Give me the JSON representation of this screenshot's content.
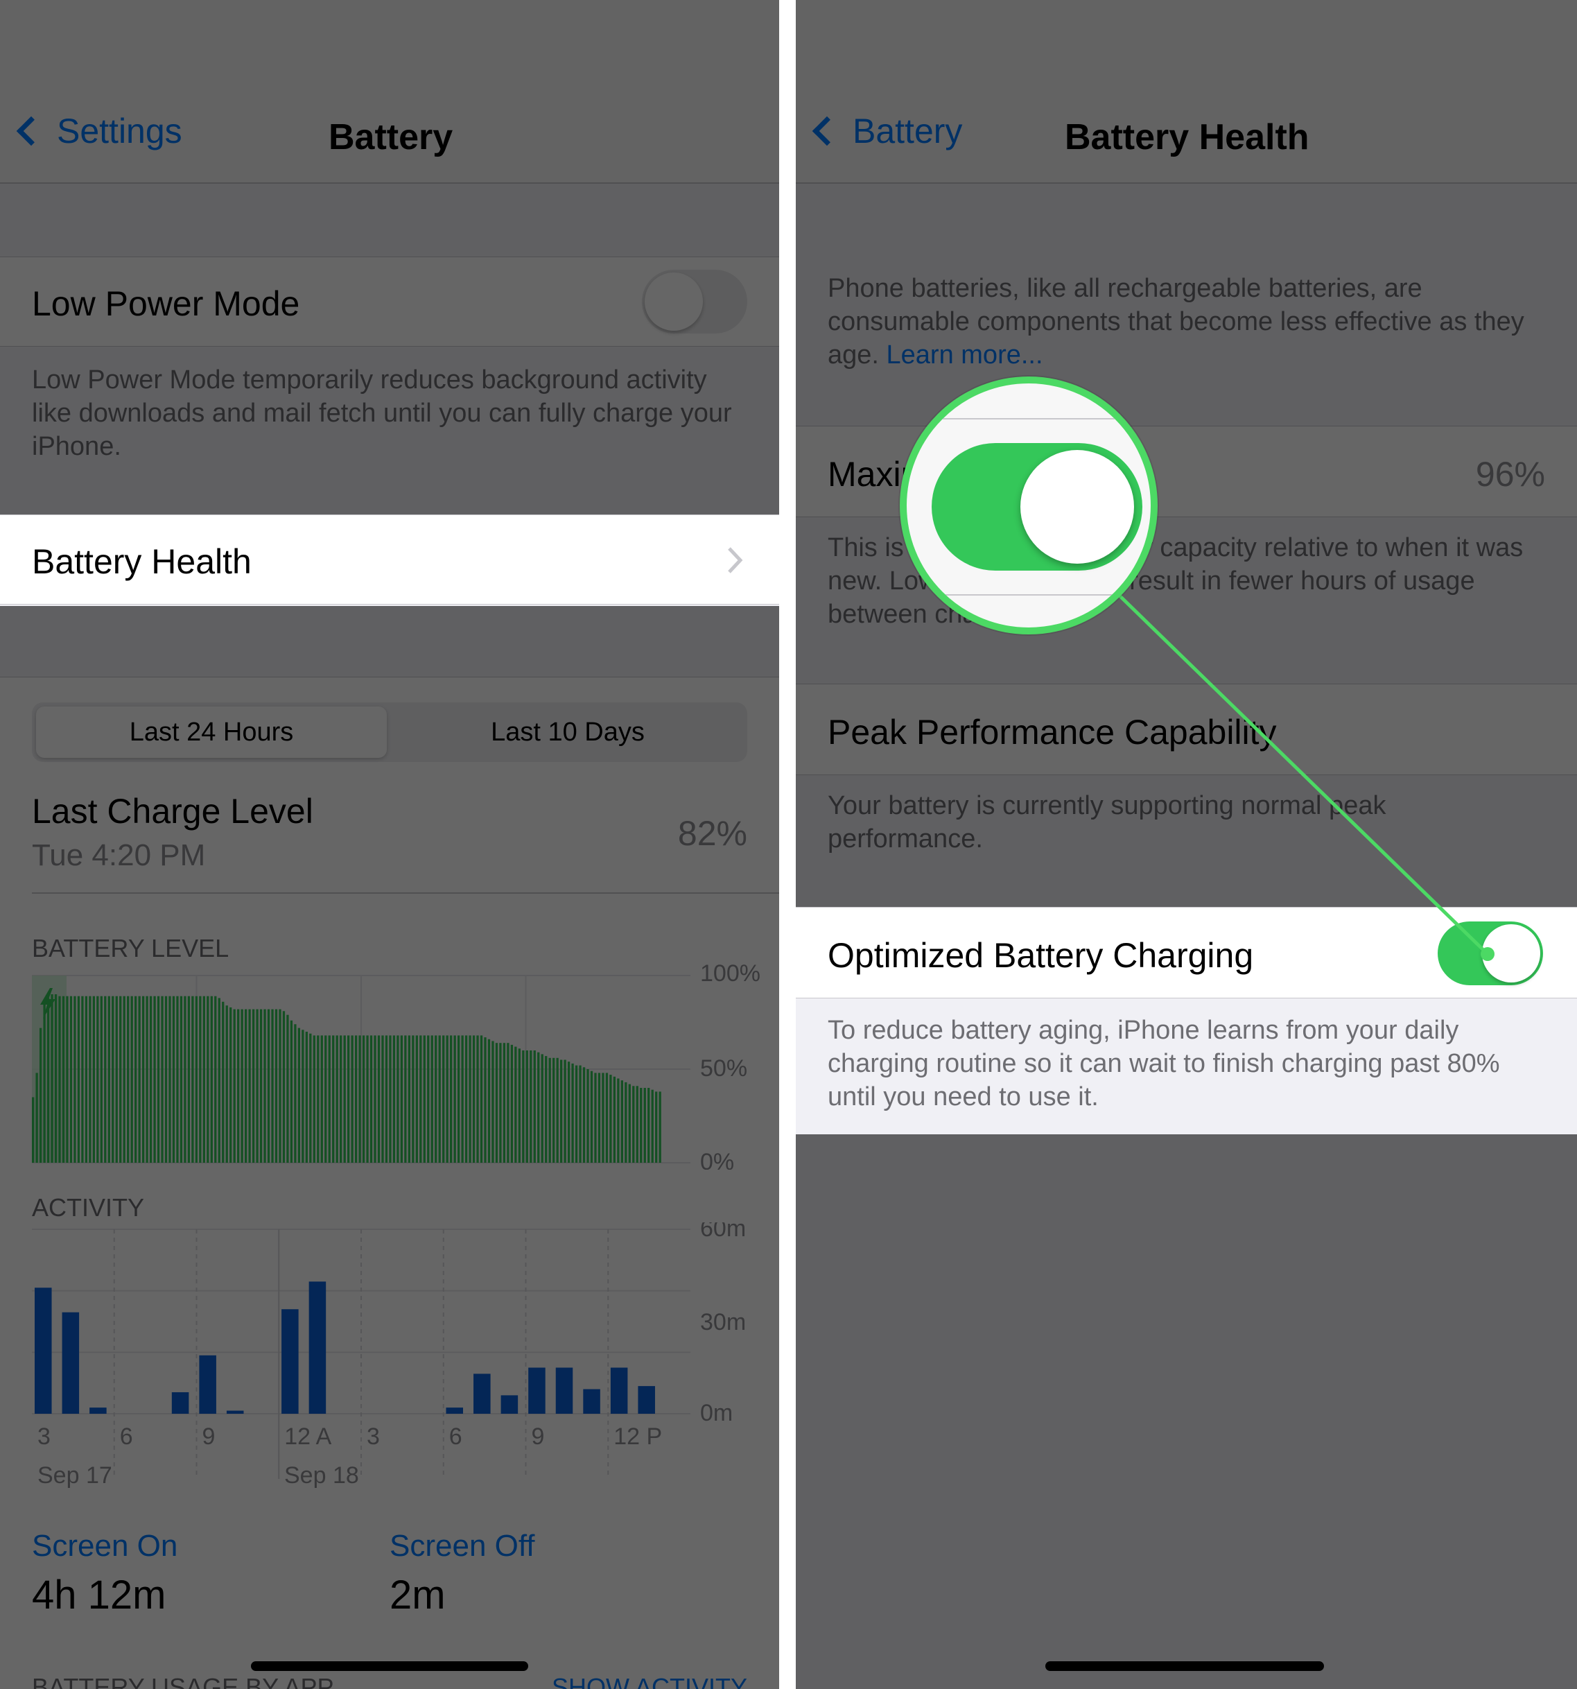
{
  "left": {
    "nav": {
      "back_label": "Settings",
      "title": "Battery"
    },
    "low_power": {
      "label": "Low Power Mode",
      "toggle_on": false,
      "footer": "Low Power Mode temporarily reduces background activity like downloads and mail fetch until you can fully charge your iPhone."
    },
    "battery_health_label": "Battery Health",
    "segments": [
      "Last 24 Hours",
      "Last 10 Days"
    ],
    "last_charge": {
      "title": "Last Charge Level",
      "time": "Tue 4:20 PM",
      "value": "82%"
    },
    "battery_level_header": "BATTERY LEVEL",
    "activity_header": "ACTIVITY",
    "stats": {
      "screen_on_label": "Screen On",
      "screen_on_value": "4h 12m",
      "screen_off_label": "Screen Off",
      "screen_off_value": "2m"
    },
    "bottom_header": "BATTERY USAGE BY APP",
    "show_activity": "SHOW ACTIVITY"
  },
  "right": {
    "nav": {
      "back_label": "Battery",
      "title": "Battery Health"
    },
    "intro_text": "Phone batteries, like all rechargeable batteries, are consumable components that become less effective as they age.",
    "learn_more": "Learn more...",
    "max_capacity": {
      "label": "Maximum Capacity",
      "value": "96%",
      "footer": "This is a measure of battery capacity relative to when it was new. Lower capacity may result in fewer hours of usage between charges."
    },
    "peak": {
      "label": "Peak Performance Capability",
      "footer": "Your battery is currently supporting normal peak performance."
    },
    "optimized": {
      "label": "Optimized Battery Charging",
      "toggle_on": true,
      "footer": "To reduce battery aging, iPhone learns from your daily charging routine so it can wait to finish charging past 80% until you need to use it."
    }
  },
  "colors": {
    "accent": "#007aff",
    "toggle_on": "#34c759",
    "highlight_green": "#4cd964",
    "battery_bar": "#34c759",
    "activity_bar": "#0a60d8"
  },
  "chart_data": [
    {
      "type": "bar",
      "title": "BATTERY LEVEL",
      "y_tick_labels": [
        "100%",
        "50%",
        "0%"
      ],
      "ylim": [
        0,
        100
      ],
      "values": [
        35,
        48,
        72,
        85,
        88,
        90,
        90,
        89,
        89,
        89,
        89,
        89,
        89,
        89,
        89,
        89,
        89,
        89,
        89,
        89,
        89,
        89,
        89,
        89,
        89,
        89,
        89,
        89,
        89,
        89,
        89,
        89,
        89,
        89,
        89,
        89,
        89,
        89,
        89,
        89,
        89,
        89,
        89,
        89,
        89,
        89,
        89,
        89,
        89,
        88,
        86,
        84,
        83,
        82,
        82,
        82,
        82,
        82,
        82,
        82,
        82,
        82,
        82,
        82,
        82,
        82,
        81,
        79,
        76,
        74,
        72,
        71,
        70,
        69,
        68,
        68,
        68,
        68,
        68,
        68,
        68,
        68,
        68,
        68,
        68,
        68,
        68,
        68,
        68,
        68,
        68,
        68,
        68,
        68,
        68,
        68,
        68,
        68,
        68,
        68,
        68,
        68,
        68,
        68,
        68,
        68,
        68,
        68,
        68,
        68,
        68,
        68,
        68,
        68,
        68,
        68,
        68,
        68,
        68,
        67,
        66,
        65,
        64,
        64,
        64,
        64,
        63,
        62,
        61,
        60,
        60,
        60,
        60,
        59,
        58,
        57,
        56,
        56,
        56,
        55,
        55,
        54,
        53,
        52,
        52,
        51,
        50,
        49,
        48,
        48,
        48,
        48,
        47,
        46,
        45,
        44,
        43,
        42,
        41,
        41,
        40,
        40,
        40,
        39,
        38,
        38
      ]
    },
    {
      "type": "bar",
      "title": "ACTIVITY",
      "y_tick_labels": [
        "60m",
        "30m",
        "0m"
      ],
      "ylim": [
        0,
        60
      ],
      "x_tick_labels": [
        "3",
        "6",
        "9",
        "12 A",
        "3",
        "6",
        "9",
        "12 P"
      ],
      "date_labels": [
        "Sep 17",
        "Sep 18"
      ],
      "values": [
        41,
        33,
        2,
        0,
        0,
        7,
        19,
        1,
        0,
        34,
        43,
        0,
        0,
        0,
        0,
        2,
        13,
        6,
        15,
        15,
        8,
        15,
        9
      ]
    }
  ]
}
